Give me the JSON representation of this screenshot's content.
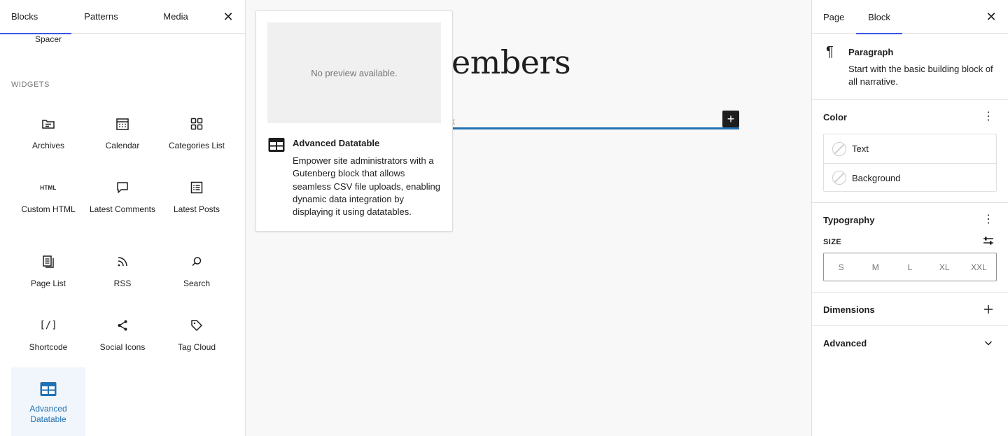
{
  "inserter": {
    "tabs": [
      "Blocks",
      "Patterns",
      "Media"
    ],
    "close_label": "✕",
    "spacer_label": "Spacer",
    "section_title": "WIDGETS",
    "blocks": [
      {
        "label": "Archives",
        "icon": "archive-icon"
      },
      {
        "label": "Calendar",
        "icon": "calendar-icon"
      },
      {
        "label": "Categories List",
        "icon": "categories-icon"
      },
      {
        "label": "Custom HTML",
        "icon": "html-icon"
      },
      {
        "label": "Latest Comments",
        "icon": "comment-icon"
      },
      {
        "label": "Latest Posts",
        "icon": "posts-list-icon"
      },
      {
        "label": "Page List",
        "icon": "page-list-icon"
      },
      {
        "label": "RSS",
        "icon": "rss-icon"
      },
      {
        "label": "Search",
        "icon": "search-icon"
      },
      {
        "label": "Shortcode",
        "icon": "shortcode-icon"
      },
      {
        "label": "Social Icons",
        "icon": "share-icon"
      },
      {
        "label": "Tag Cloud",
        "icon": "tag-icon"
      },
      {
        "label": "Advanced Datatable",
        "icon": "datatable-icon"
      }
    ],
    "html_icon_text": "HTML",
    "shortcode_icon_text": "[/]"
  },
  "canvas": {
    "heading_fragment": "embers",
    "caret": "k",
    "add_label": "+"
  },
  "preview": {
    "no_preview": "No preview available.",
    "title": "Advanced Datatable",
    "description": "Empower site administrators with a Gutenberg block that allows seamless CSV file uploads, enabling dynamic data integration by displaying it using datatables."
  },
  "settings": {
    "tabs": [
      "Page",
      "Block"
    ],
    "close_label": "✕",
    "block_card": {
      "icon_glyph": "¶",
      "title": "Paragraph",
      "description": "Start with the basic building block of all narrative."
    },
    "color": {
      "title": "Color",
      "items": [
        "Text",
        "Background"
      ]
    },
    "typography": {
      "title": "Typography",
      "size_label": "SIZE",
      "sizes": [
        "S",
        "M",
        "L",
        "XL",
        "XXL"
      ]
    },
    "dimensions": {
      "title": "Dimensions"
    },
    "advanced": {
      "title": "Advanced"
    }
  },
  "colors": {
    "accent": "#3858e9",
    "selected_blue": "#2271b1",
    "selected_bg": "#f0f6fc"
  }
}
